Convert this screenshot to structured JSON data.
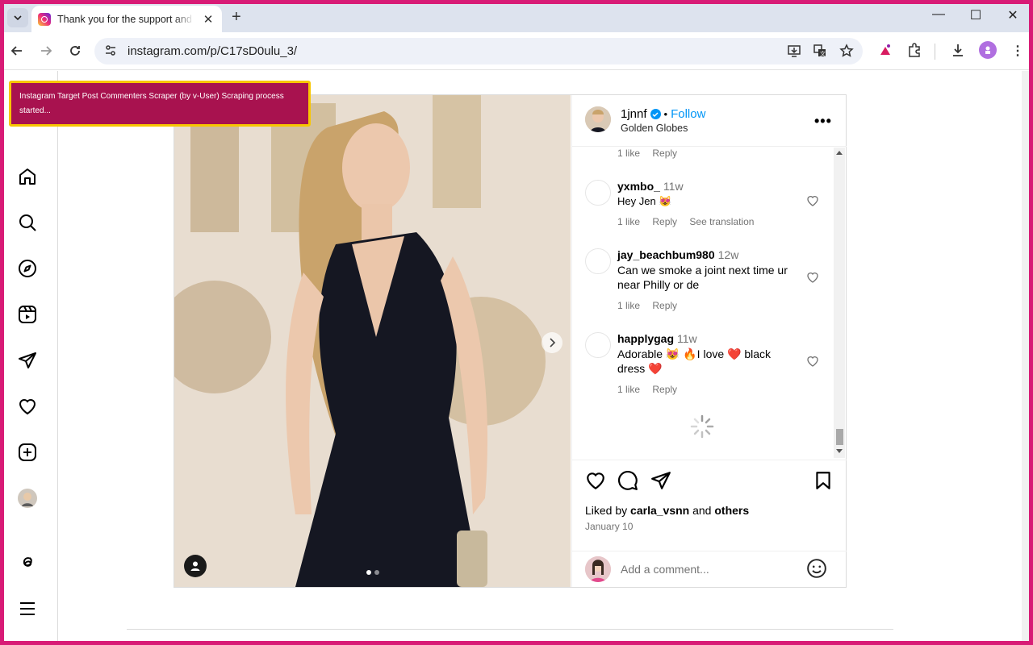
{
  "browser": {
    "tab_title": "Thank you for the support and ",
    "url": "instagram.com/p/C17sD0ulu_3/"
  },
  "toast": {
    "message": "Instagram Target Post Commenters Scraper (by v-User) Scraping process started..."
  },
  "post": {
    "username": "1jnnf",
    "follow_label": "Follow",
    "location": "Golden Globes",
    "comments": [
      {
        "user": "",
        "time": "",
        "text": "",
        "likes": "1 like",
        "reply": "Reply",
        "translate": ""
      },
      {
        "user": "yxmbo_",
        "time": "11w",
        "text": "Hey Jen 😻",
        "likes": "1 like",
        "reply": "Reply",
        "translate": "See translation"
      },
      {
        "user": "jay_beachbum980",
        "time": "12w",
        "text": "Can we smoke a joint next time ur near Philly or de",
        "likes": "1 like",
        "reply": "Reply",
        "translate": ""
      },
      {
        "user": "happlygag",
        "time": "11w",
        "text": "Adorable 😻 🔥I love ❤️ black dress ❤️",
        "likes": "1 like",
        "reply": "Reply",
        "translate": ""
      }
    ],
    "liked_by_prefix": "Liked by",
    "liked_by_user": "carla_vsnn",
    "liked_by_and": "and",
    "liked_by_others": "others",
    "date": "January 10",
    "add_comment_placeholder": "Add a comment..."
  },
  "colors": {
    "accent_blue": "#0095f6",
    "toast_bg": "#a8124f",
    "toast_border": "#f7c600",
    "frame": "#d81b76"
  },
  "icons": {
    "sidebar": [
      "home-icon",
      "search-icon",
      "explore-icon",
      "reels-icon",
      "messages-icon",
      "notifications-icon",
      "create-icon",
      "profile-avatar",
      "threads-icon",
      "menu-icon"
    ]
  }
}
